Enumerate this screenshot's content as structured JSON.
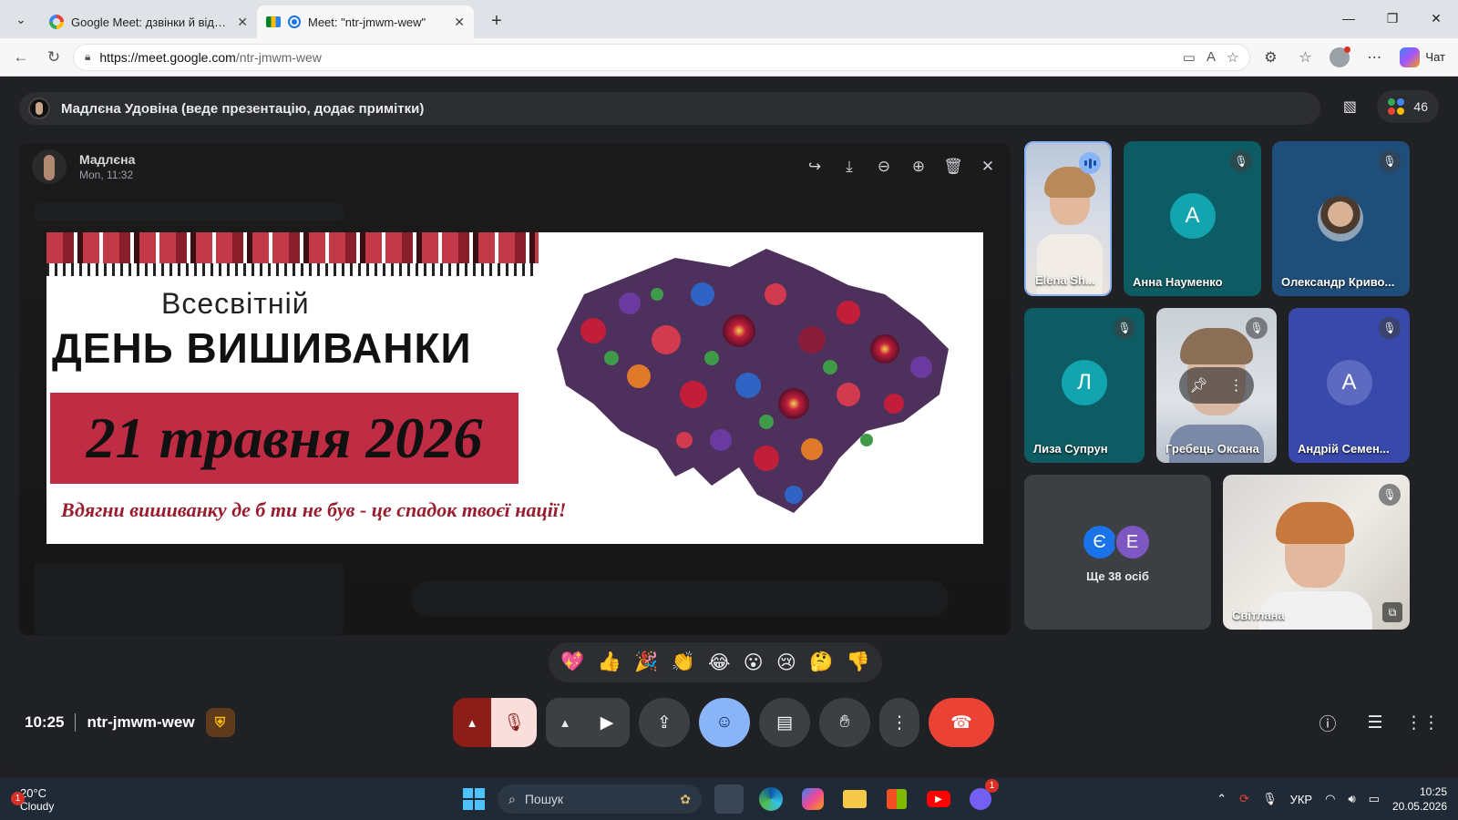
{
  "browser": {
    "tabs": [
      {
        "title": "Google Meet: дзвінки й відеоконф",
        "active": false
      },
      {
        "title": "Meet: \"ntr-jmwm-wew\"",
        "active": true
      }
    ],
    "url_host": "https://meet.google.com",
    "url_path": "/ntr-jmwm-wew",
    "chat_label": "Чат"
  },
  "meet": {
    "presenter_text": "Мадлєна Удовіна (веде презентацію, додає примітки)",
    "participant_count": "46",
    "viewer": {
      "sender": "Мадлєна",
      "time": "Mon, 11:32"
    },
    "slide": {
      "line1": "Всесвітній",
      "line2": "ДЕНЬ ВИШИВАНКИ",
      "date": "21 травня 2026",
      "quote": "Вдягни вишиванку де б ти не був - це спадок твоєї нації!"
    },
    "tiles": [
      {
        "name": "Elena Sh...",
        "kind": "photo",
        "speaking": true
      },
      {
        "name": "Анна Науменко",
        "initial": "А",
        "color": "#12a4af",
        "bg": "#0d5c63"
      },
      {
        "name": "Олександр Криво...",
        "kind": "photo"
      },
      {
        "name": "Лиза Супрун",
        "initial": "Л",
        "color": "#12a4af",
        "bg": "#0d5c63"
      },
      {
        "name": "Гребець Оксана",
        "kind": "photo"
      },
      {
        "name": "Андрій Семен...",
        "initial": "А",
        "color": "#5c6bc0",
        "bg": "#3949ab"
      },
      {
        "name": "Світлана",
        "kind": "photo"
      }
    ],
    "more": {
      "initials": [
        "Є",
        "Е"
      ],
      "colors": [
        "#1a73e8",
        "#7e57c2"
      ],
      "label": "Ще 38 осіб"
    },
    "reactions": [
      "💖",
      "👍",
      "🎉",
      "👏",
      "😂",
      "😮",
      "😢",
      "🤔",
      "👎"
    ],
    "time": "10:25",
    "meeting_code": "ntr-jmwm-wew"
  },
  "taskbar": {
    "temperature": "20°C",
    "weather": "Cloudy",
    "weather_badge": "1",
    "search_placeholder": "Пошук",
    "language": "УКР",
    "clock_time": "10:25",
    "clock_date": "20.05.2026",
    "viber_badge": "1"
  }
}
